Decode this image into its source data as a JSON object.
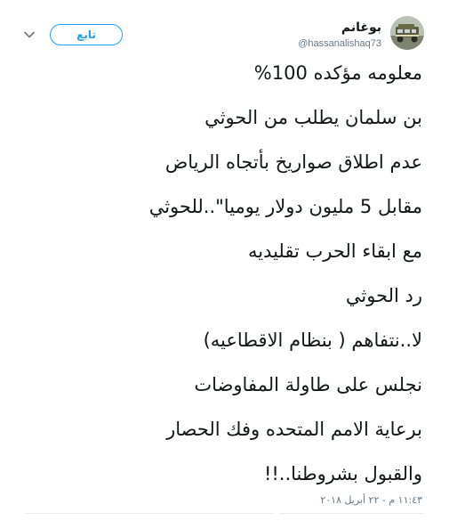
{
  "tweet": {
    "author": {
      "display_name": "بوغانم",
      "handle": "@hassanalishaq73",
      "avatar_icon": "avatar-image"
    },
    "follow_label": "تابع",
    "menu_icon": "chevron-down-icon",
    "lines": [
      "معلومه مؤكده 100%",
      "بن سلمان يطلب من الحوثي",
      "عدم اطلاق صواريخ بأتجاه الرياض",
      "مقابل 5 مليون دولار يوميا\"..للحوثي",
      "مع ابقاء الحرب تقليديه",
      "رد الحوثي",
      "لا..نتفاهم ( بنظام الاقطاعيه)",
      "نجلس على طاولة المفاوضات",
      "برعاية الامم المتحده وفك الحصار",
      "والقبول بشروطنا..!!"
    ],
    "timestamp": "١١:٤٣ م - ٢٢ أبريل ٢٠١٨",
    "colors": {
      "accent": "#1da1f2",
      "text": "#14171a",
      "muted": "#657786"
    }
  }
}
